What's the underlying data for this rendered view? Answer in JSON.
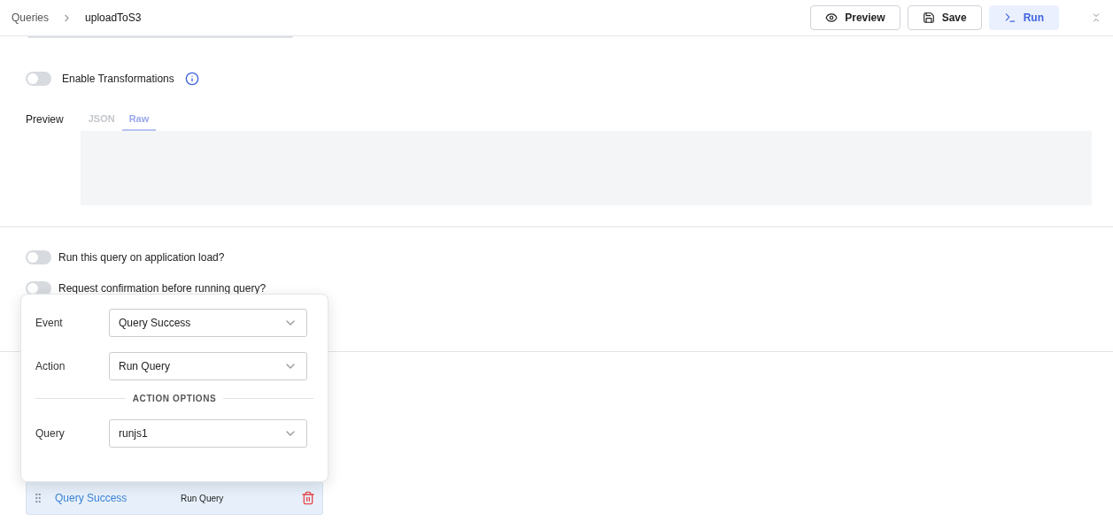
{
  "breadcrumb": {
    "parent": "Queries",
    "current": "uploadToS3"
  },
  "header_buttons": [
    {
      "kind": "preview",
      "label": "Preview"
    },
    {
      "kind": "save",
      "label": "Save"
    },
    {
      "kind": "run",
      "label": "Run"
    }
  ],
  "transformations": {
    "label": "Enable Transformations",
    "on": false
  },
  "preview": {
    "label": "Preview",
    "tabs": [
      {
        "label": "JSON",
        "selected": false
      },
      {
        "label": "Raw",
        "selected": true
      }
    ]
  },
  "settings": [
    {
      "label": "Run this query on application load?",
      "on": false
    },
    {
      "label": "Request confirmation before running query?",
      "on": false
    }
  ],
  "event_popover": {
    "fields": [
      {
        "label": "Event",
        "value": "Query Success"
      },
      {
        "label": "Action",
        "value": "Run Query"
      }
    ],
    "section_title": "ACTION OPTIONS",
    "options": [
      {
        "label": "Query",
        "value": "runjs1"
      }
    ]
  },
  "events": [
    {
      "event": "Query Success",
      "action": "Run Query"
    }
  ]
}
